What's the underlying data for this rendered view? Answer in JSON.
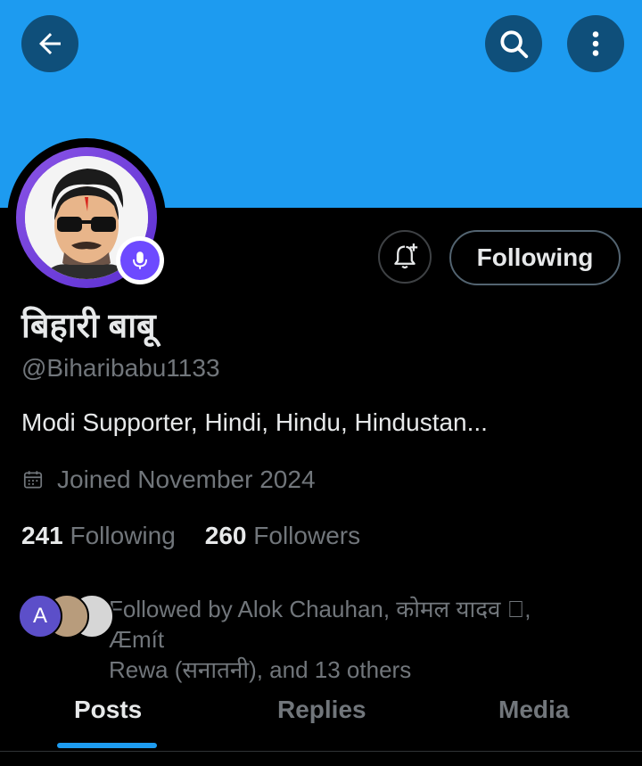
{
  "header": {
    "back_icon": "arrow-left-icon",
    "search_icon": "search-icon",
    "more_icon": "more-vertical-icon",
    "banner_color": "#1d9bf0"
  },
  "profile": {
    "name": "बिहारी बाबू",
    "handle": "@Biharibabu1133",
    "bio": "Modi Supporter, Hindi, Hindu, Hindustan...",
    "joined": "Joined November 2024",
    "following_count": "241",
    "following_label": "Following",
    "followers_count": "260",
    "followers_label": "Followers",
    "avatar_ring_color": "#7b4ee0",
    "badge_icon": "mic-icon"
  },
  "actions": {
    "notify_icon": "bell-plus-icon",
    "following_button_label": "Following"
  },
  "followed_by": {
    "first_avatar_letter": "A",
    "text_line1": "Followed by Alok Chauhan, कोमल यादव ⃣, Æmít",
    "text_line2": "Rewa (सनातनी), and 13 others"
  },
  "tabs": [
    {
      "label": "Posts",
      "active": true
    },
    {
      "label": "Replies",
      "active": false
    },
    {
      "label": "Media",
      "active": false
    }
  ],
  "accent_color": "#1d9bf0"
}
